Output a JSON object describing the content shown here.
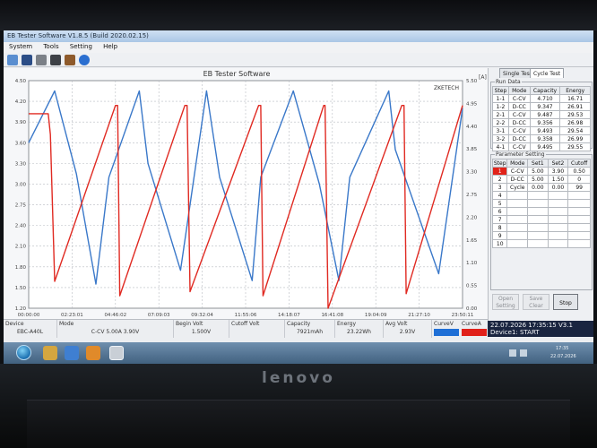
{
  "window": {
    "title": "EB Tester Software V1.8.5 (Build 2020.02.15)"
  },
  "menu": [
    "System",
    "Tools",
    "Setting",
    "Help"
  ],
  "toolbar_icons": [
    "open-icon",
    "save-icon",
    "print-icon",
    "tools-icon",
    "settings-icon",
    "info-icon"
  ],
  "chart": {
    "title": "EB Tester Software",
    "unit_left": "",
    "unit_right": "[A]",
    "brand": "ZKETECH"
  },
  "chart_data": {
    "type": "line",
    "x_ticks": [
      "00:00:00",
      "02:23:01",
      "04:46:02",
      "07:09:03",
      "09:32:04",
      "11:55:06",
      "14:18:07",
      "16:41:08",
      "19:04:09",
      "21:27:10",
      "23:50:11"
    ],
    "left_axis_ticks": [
      "1.20",
      "1.50",
      "1.80",
      "2.10",
      "2.40",
      "2.75",
      "3.00",
      "3.30",
      "3.60",
      "3.90",
      "4.20",
      "4.50"
    ],
    "right_axis_ticks": [
      "0.00",
      "0.55",
      "1.10",
      "1.65",
      "2.20",
      "2.75",
      "3.30",
      "3.85",
      "4.40",
      "4.95",
      "5.50"
    ],
    "ylim_right": [
      0,
      5.5
    ],
    "series": [
      {
        "name": "",
        "axis": "left",
        "color": "#3a78c9",
        "x_frac": [
          0.0,
          0.06,
          0.11,
          0.155,
          0.185,
          0.255,
          0.275,
          0.35,
          0.41,
          0.44,
          0.515,
          0.535,
          0.61,
          0.67,
          0.715,
          0.74,
          0.83,
          0.845,
          0.945,
          1.0
        ],
        "y": [
          3.6,
          4.35,
          3.15,
          1.55,
          3.1,
          4.35,
          3.3,
          1.75,
          4.35,
          3.1,
          1.6,
          3.1,
          4.35,
          3.0,
          1.6,
          3.1,
          4.35,
          3.5,
          1.7,
          4.1
        ]
      },
      {
        "name": "",
        "axis": "right",
        "color": "#e02a22",
        "x_frac": [
          0.0,
          0.045,
          0.05,
          0.06,
          0.2,
          0.205,
          0.21,
          0.36,
          0.365,
          0.372,
          0.53,
          0.535,
          0.54,
          0.68,
          0.683,
          0.69,
          0.86,
          0.865,
          0.87,
          1.0
        ],
        "y": [
          4.7,
          4.7,
          4.2,
          0.65,
          4.9,
          4.9,
          0.3,
          4.9,
          4.9,
          0.4,
          4.9,
          4.9,
          0.3,
          4.9,
          4.9,
          0.0,
          4.9,
          4.9,
          0.35,
          4.9
        ]
      }
    ]
  },
  "info": {
    "device_label": "Device",
    "device_value": "EBC-A40L",
    "mode_label": "Mode",
    "mode_value": "C-CV 5.00A 3.90V",
    "begin_volt_label": "Begin Volt",
    "begin_volt_value": "1.500V",
    "cutoff_volt_label": "Cutoff Volt",
    "cutoff_volt_value": "",
    "capacity_label": "Capacity",
    "capacity_value": "7921mAh",
    "energy_label": "Energy",
    "energy_value": "23.22Wh",
    "avg_volt_label": "Avg Volt",
    "avg_volt_value": "2.93V",
    "curve_v_label": "CurveV",
    "curve_a_label": "CurveA",
    "curve_v_color": "#1f6fd6",
    "curve_a_color": "#e0201a"
  },
  "side": {
    "tab_single": "Single Test",
    "tab_cycle": "Cycle Test",
    "run_data_title": "Run Data",
    "run_headers": [
      "Step",
      "Mode",
      "Capacity",
      "Energy"
    ],
    "run_rows": [
      [
        "1-1",
        "C-CV",
        "4.710",
        "16.71"
      ],
      [
        "1-2",
        "D-CC",
        "9.347",
        "26.91"
      ],
      [
        "2-1",
        "C-CV",
        "9.487",
        "29.53"
      ],
      [
        "2-2",
        "D-CC",
        "9.356",
        "26.98"
      ],
      [
        "3-1",
        "C-CV",
        "9.493",
        "29.54"
      ],
      [
        "3-2",
        "D-CC",
        "9.358",
        "26.99"
      ],
      [
        "4-1",
        "C-CV",
        "9.495",
        "29.55"
      ]
    ],
    "param_title": "Parameter Setting",
    "param_headers": [
      "Step",
      "Mode",
      "Set1",
      "Set2",
      "Cutoff"
    ],
    "param_rows": [
      [
        "1",
        "C-CV",
        "5.00",
        "3.90",
        "0.50"
      ],
      [
        "2",
        "D-CC",
        "5.00",
        "1.50",
        "0"
      ],
      [
        "3",
        "Cycle",
        "0.00",
        "0.00",
        "99"
      ],
      [
        "4",
        "",
        "",
        "",
        ""
      ],
      [
        "5",
        "",
        "",
        "",
        ""
      ],
      [
        "6",
        "",
        "",
        "",
        ""
      ],
      [
        "7",
        "",
        "",
        "",
        ""
      ],
      [
        "8",
        "",
        "",
        "",
        ""
      ],
      [
        "9",
        "",
        "",
        "",
        ""
      ],
      [
        "10",
        "",
        "",
        "",
        ""
      ]
    ],
    "btn_open": "Open Setting",
    "btn_save": "Save Clear",
    "btn_stop": "Stop"
  },
  "status": {
    "datetime": "22.07.2026 17:35:15",
    "version": "V3.1",
    "device_state": "Device1: START"
  },
  "taskbar": {
    "clock_time": "17:35",
    "clock_date": "22.07.2026",
    "brand_logo": "lenovo"
  }
}
